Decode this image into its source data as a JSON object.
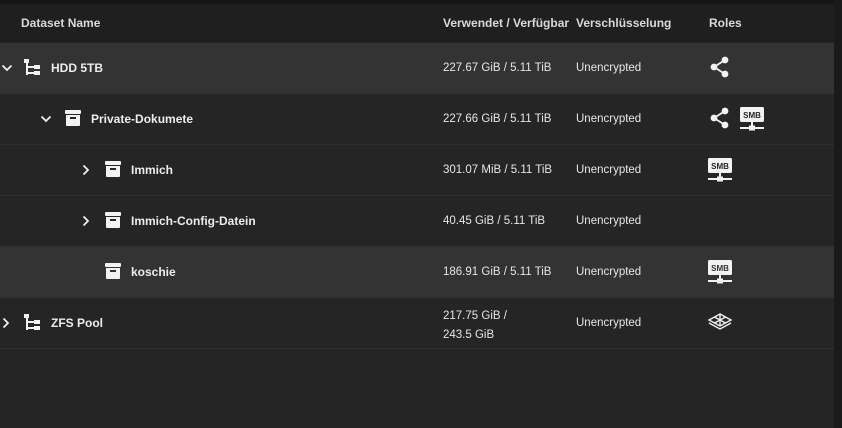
{
  "header": {
    "dataset_name": "Dataset Name",
    "used_available": "Verwendet / Verfügbar",
    "encryption": "Verschlüsselung",
    "roles": "Roles"
  },
  "rows": [
    {
      "name": "HDD 5TB",
      "expander": "chevron-down",
      "icon": "pool-tree-icon",
      "used": "227.67 GiB / 5.11 TiB",
      "encryption": "Unencrypted",
      "roles": [
        "share-icon"
      ],
      "highlighted": true
    },
    {
      "name": "Private-Dokumete",
      "expander": "chevron-down",
      "icon": "dataset-icon",
      "used": "227.66 GiB / 5.11 TiB",
      "encryption": "Unencrypted",
      "roles": [
        "share-icon",
        "smb-share-icon"
      ],
      "highlighted": false
    },
    {
      "name": "Immich",
      "expander": "chevron-right",
      "icon": "dataset-icon",
      "used": "301.07 MiB / 5.11 TiB",
      "encryption": "Unencrypted",
      "roles": [
        "smb-share-icon"
      ],
      "highlighted": false
    },
    {
      "name": "Immich-Config-Datein",
      "expander": "chevron-right",
      "icon": "dataset-icon",
      "used": "40.45 GiB / 5.11 TiB",
      "encryption": "Unencrypted",
      "roles": [],
      "highlighted": false
    },
    {
      "name": "koschie",
      "expander": "",
      "icon": "dataset-icon",
      "used": "186.91 GiB / 5.11 TiB",
      "encryption": "Unencrypted",
      "roles": [
        "smb-share-icon"
      ],
      "highlighted": true
    },
    {
      "name": "ZFS Pool",
      "expander": "chevron-right",
      "icon": "pool-tree-icon",
      "used_line1": "217.75 GiB /",
      "used_line2": "243.5 GiB",
      "encryption": "Unencrypted",
      "roles": [
        "system-dataset-icon"
      ],
      "highlighted": false
    }
  ],
  "role_labels": {
    "smb": "SMB"
  }
}
